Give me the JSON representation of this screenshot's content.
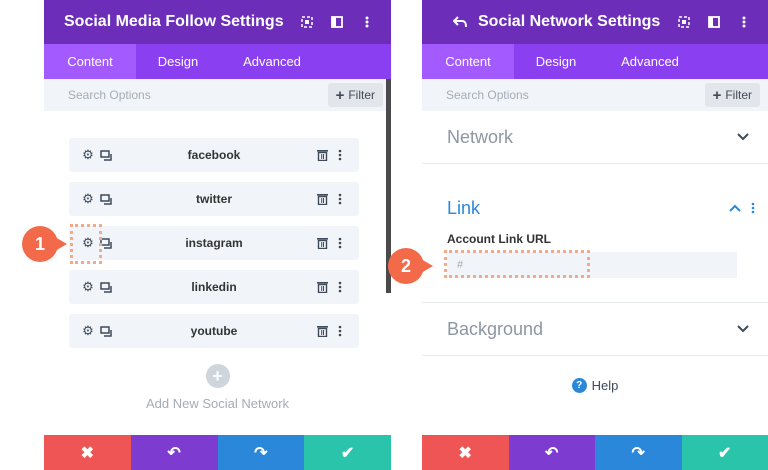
{
  "left_panel": {
    "title": "Social Media Follow Settings",
    "tabs": [
      {
        "label": "Content"
      },
      {
        "label": "Design"
      },
      {
        "label": "Advanced"
      }
    ],
    "search": {
      "placeholder": "Search Options",
      "filter_label": "Filter"
    },
    "networks": [
      {
        "label": "facebook"
      },
      {
        "label": "twitter"
      },
      {
        "label": "instagram"
      },
      {
        "label": "linkedin"
      },
      {
        "label": "youtube"
      }
    ],
    "add_label": "Add New Social Network"
  },
  "right_panel": {
    "title": "Social Network Settings",
    "tabs": [
      {
        "label": "Content"
      },
      {
        "label": "Design"
      },
      {
        "label": "Advanced"
      }
    ],
    "search": {
      "placeholder": "Search Options",
      "filter_label": "Filter"
    },
    "sections": {
      "network": "Network",
      "link": "Link",
      "background": "Background"
    },
    "field_label": "Account Link URL",
    "field_value": "#",
    "help_label": "Help"
  },
  "callouts": {
    "one": "1",
    "two": "2"
  },
  "colors": {
    "header": "#6c2eb9",
    "tabs": "#8a3ff0",
    "tab_active": "#a35bff",
    "cancel": "#ef5555",
    "undo": "#7e3bd0",
    "redo": "#2b87da",
    "save": "#29c4a9",
    "callout": "#f26a4a"
  }
}
